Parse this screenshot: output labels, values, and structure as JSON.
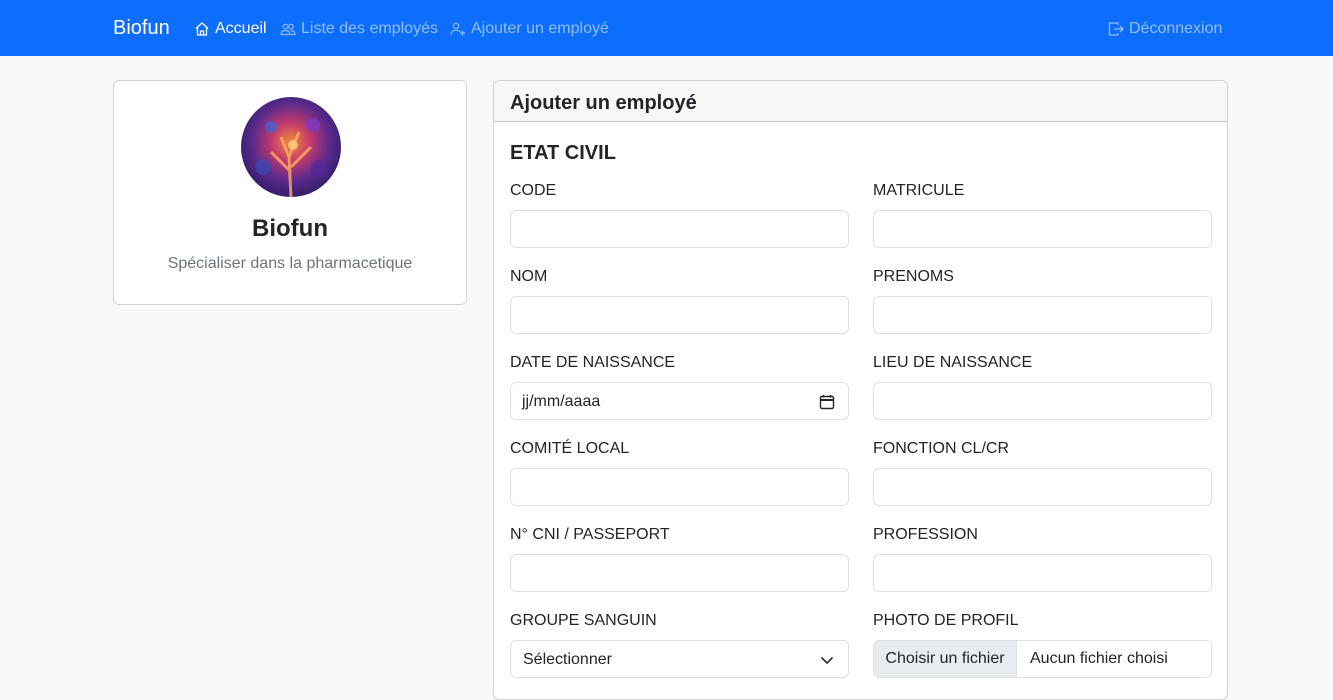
{
  "navbar": {
    "brand": "Biofun",
    "links": [
      {
        "label": "Accueil",
        "icon": "house-icon"
      },
      {
        "label": "Liste des employés",
        "icon": "people-icon"
      },
      {
        "label": "Ajouter un employé",
        "icon": "person-add-icon"
      }
    ],
    "logout": {
      "label": "Déconnexion",
      "icon": "box-arrow-right-icon"
    },
    "color": "#0d6efd"
  },
  "profile": {
    "name": "Biofun",
    "description": "Spécialiser dans la pharmacetique"
  },
  "form": {
    "header": "Ajouter un employé",
    "section": "ETAT CIVIL",
    "fields": {
      "code": {
        "label": "CODE",
        "value": ""
      },
      "matricule": {
        "label": "MATRICULE",
        "value": ""
      },
      "nom": {
        "label": "NOM",
        "value": ""
      },
      "prenoms": {
        "label": "PRENOMS",
        "value": ""
      },
      "date_naissance": {
        "label": "DATE DE NAISSANCE",
        "value": "jj/mm/aaaa"
      },
      "lieu_naissance": {
        "label": "LIEU DE NAISSANCE",
        "value": ""
      },
      "comite_local": {
        "label": "COMITÉ LOCAL",
        "value": ""
      },
      "fonction": {
        "label": "FONCTION CL/CR",
        "value": ""
      },
      "cni": {
        "label": "N° CNI / PASSEPORT",
        "value": ""
      },
      "profession": {
        "label": "PROFESSION",
        "value": ""
      },
      "groupe_sanguin": {
        "label": "GROUPE SANGUIN",
        "value": "Sélectionner"
      },
      "photo": {
        "label": "PHOTO DE PROFIL",
        "button": "Choisir un fichier",
        "filename": "Aucun fichier choisi"
      }
    }
  }
}
